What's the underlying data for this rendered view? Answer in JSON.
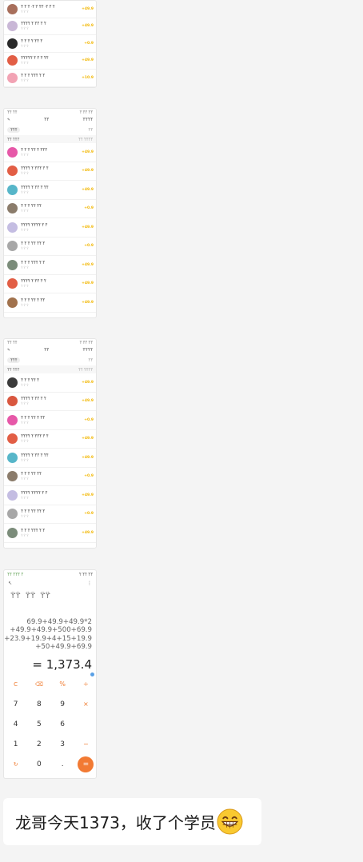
{
  "screenshot_1": {
    "rows": [
      {
        "name": "ϔ ϔ  ϔ   ·ϔ  ϔ  ϔϔ ·ϔ  ϔ  ϔ",
        "time": "ϔ  ϔ  ϔ",
        "amount": "+49.9",
        "avatar_color": "#a86f5c"
      },
      {
        "name": "ϔϔϔϔ ϔ ϔϔ  ϔ  ϔ",
        "time": "ϔ  ϔ  ϔ",
        "amount": "+49.9",
        "avatar_color": "#c9b7d6"
      },
      {
        "name": "ϔ ϔ  ϔ  ϔ ϔϔ ϔ",
        "time": "ϔ  ϔ  ϔ",
        "amount": "+0.9",
        "avatar_color": "#2a2a2a"
      },
      {
        "name": "ϔϔϔϔϔ  ϔ ϔ  ϔ ϔϔ",
        "time": "ϔ  ϔ  ϔ",
        "amount": "+49.9",
        "avatar_color": "#e25e45"
      },
      {
        "name": "ϔ ϔ  ϔ ϔϔϔ  ϔ ϔ",
        "time": "ϔ  ϔ  ϔ",
        "amount": "+10.9",
        "avatar_color": "#f2a3b4"
      }
    ]
  },
  "screenshot_2": {
    "status_left": "ϔϔ ϔϔ",
    "status_right": "ϔ ϔϔ ϔϔ",
    "top_left": "✎",
    "top_center": "ϔϔ",
    "top_right": "ϔϔϔϔ",
    "filter_pill": "ϔϔϔ",
    "filter_end": "ϔϔ",
    "summary_left": "ϔϔ ϔϔϔ",
    "summary_right": "ϔϔ ϔϔϔϔ",
    "rows": [
      {
        "name": "ϔ ϔ  ϔ ϔϔ  ϔ ϔϔϔ",
        "time": "ϔ  ϔ  ϔ",
        "amount": "+49.9",
        "avatar_color": "#e658a8"
      },
      {
        "name": "ϔϔϔϔ ϔ  ϔϔϔ  ϔ ϔ",
        "time": "ϔ  ϔ  ϔ",
        "amount": "+49.9",
        "avatar_color": "#e25e45"
      },
      {
        "name": "ϔϔϔϔ ϔ ϔϔ ϔ  ϔϔ",
        "time": "ϔ  ϔ  ϔ",
        "amount": "+49.9",
        "avatar_color": "#57b6c9"
      },
      {
        "name": "ϔ ϔ  ϔ ϔϔ  ϔϔ",
        "time": "ϔ  ϔ  ϔ",
        "amount": "+0.9",
        "avatar_color": "#8b7c6b"
      },
      {
        "name": "ϔϔϔϔ  ϔϔϔϔ  ϔ ϔ",
        "time": "ϔ  ϔ  ϔ",
        "amount": "+49.9",
        "avatar_color": "#c4bde2"
      },
      {
        "name": "ϔ ϔ  ϔ ϔϔ ϔϔ ϔ",
        "time": "ϔ  ϔ  ϔ",
        "amount": "+0.9",
        "avatar_color": "#a7a7a7"
      },
      {
        "name": "ϔ ϔ  ϔ ϔϔϔ ϔ  ϔ",
        "time": "ϔ  ϔ  ϔ",
        "amount": "+49.9",
        "avatar_color": "#7b8c7a"
      },
      {
        "name": "ϔϔϔϔ ϔ  ϔϔ  ϔ ϔ",
        "time": "ϔ  ϔ  ϔ",
        "amount": "+49.9",
        "avatar_color": "#e25e45"
      },
      {
        "name": "ϔ ϔ  ϔ ϔϔ ϔ  ϔϔ",
        "time": "ϔ  ϔ  ϔ",
        "amount": "+49.9",
        "avatar_color": "#a1724d"
      }
    ]
  },
  "screenshot_3": {
    "status_left": "ϔϔ ϔϔ",
    "status_right": "ϔ ϔϔ ϔϔ",
    "top_left": "✎",
    "top_center": "ϔϔ",
    "top_right": "ϔϔϔϔ",
    "filter_pill": "ϔϔϔ",
    "filter_end": "ϔϔ",
    "summary_left": "ϔϔ ϔϔϔ",
    "summary_right": "ϔϔ ϔϔϔϔ",
    "rows": [
      {
        "name": "ϔ ϔ  ϔ ϔϔ ϔ",
        "time": "ϔ  ϔ  ϔ",
        "amount": "+49.9",
        "avatar_color": "#3b3b3b"
      },
      {
        "name": "ϔϔϔϔ ϔ ϔϔ  ϔ ϔ",
        "time": "ϔ  ϔ  ϔ",
        "amount": "+49.9",
        "avatar_color": "#d9573f"
      },
      {
        "name": "ϔ ϔ  ϔ ϔϔ  ϔ ϔϔ",
        "time": "ϔ  ϔ  ϔ",
        "amount": "+0.9",
        "avatar_color": "#e658a8"
      },
      {
        "name": "ϔϔϔϔ ϔ  ϔϔϔ  ϔ ϔ",
        "time": "ϔ  ϔ  ϔ",
        "amount": "+49.9",
        "avatar_color": "#e25e45"
      },
      {
        "name": "ϔϔϔϔ ϔ ϔϔ ϔ  ϔϔ",
        "time": "ϔ  ϔ  ϔ",
        "amount": "+49.9",
        "avatar_color": "#57b6c9"
      },
      {
        "name": "ϔ ϔ  ϔ ϔϔ  ϔϔ",
        "time": "ϔ  ϔ  ϔ",
        "amount": "+0.9",
        "avatar_color": "#8b7c6b"
      },
      {
        "name": "ϔϔϔϔ  ϔϔϔϔ  ϔ ϔ",
        "time": "ϔ  ϔ  ϔ",
        "amount": "+49.9",
        "avatar_color": "#c4bde2"
      },
      {
        "name": "ϔ ϔ  ϔ ϔϔ ϔϔ ϔ",
        "time": "ϔ  ϔ  ϔ",
        "amount": "+0.9",
        "avatar_color": "#a7a7a7"
      },
      {
        "name": "ϔ ϔ  ϔ ϔϔϔ ϔ  ϔ",
        "time": "ϔ  ϔ  ϔ",
        "amount": "+49.9",
        "avatar_color": "#7b8c7a"
      }
    ]
  },
  "calculator": {
    "status_left": "ϔϔ ϔϔϔ ϔ",
    "status_right": "ϔ ϔϔ ϔϔ",
    "nav_left": "↖",
    "nav_right": "⋮",
    "tabs": [
      "ϔϔ",
      "ϔϔ",
      "ϔϔ"
    ],
    "expression_lines": [
      "69.9+49.9+49.9*2",
      "+49.9+49.9+500+69.9",
      "+23.9+19.9+4+15+19.9",
      "+50+49.9+69.9"
    ],
    "result": "= 1,373.4",
    "keys": [
      {
        "label": "C",
        "style": "fn"
      },
      {
        "label": "⌫",
        "style": "fn"
      },
      {
        "label": "%",
        "style": "op"
      },
      {
        "label": "÷",
        "style": "op"
      },
      {
        "label": "7",
        "style": "num"
      },
      {
        "label": "8",
        "style": "num"
      },
      {
        "label": "9",
        "style": "num"
      },
      {
        "label": "×",
        "style": "op"
      },
      {
        "label": "4",
        "style": "num"
      },
      {
        "label": "5",
        "style": "num"
      },
      {
        "label": "6",
        "style": "num"
      },
      {
        "label": "",
        "style": "op"
      },
      {
        "label": "1",
        "style": "num"
      },
      {
        "label": "2",
        "style": "num"
      },
      {
        "label": "3",
        "style": "num"
      },
      {
        "label": "−",
        "style": "op"
      },
      {
        "label": "↻",
        "style": "fn"
      },
      {
        "label": "0",
        "style": "num"
      },
      {
        "label": ".",
        "style": "num"
      },
      {
        "label": "=",
        "style": "eq"
      }
    ]
  },
  "message": {
    "text": "龙哥今天1373，收了个学员",
    "emoji": "grinning-face-icon"
  }
}
